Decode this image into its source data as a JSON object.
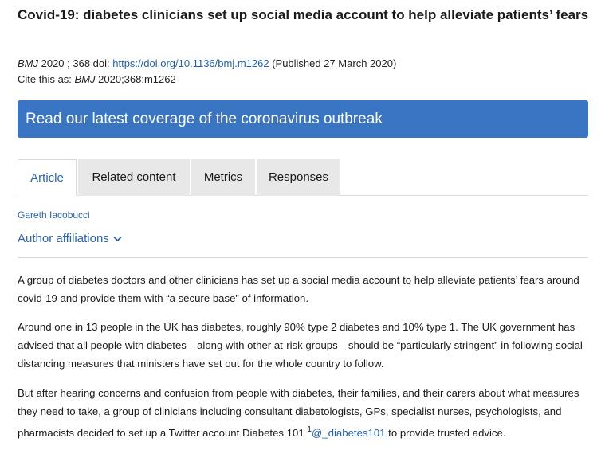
{
  "article": {
    "title": "Covid-19: diabetes clinicians set up social media account to help alleviate patients’ fears",
    "journal": "BMJ",
    "year_vol": " 2020 ; 368 ",
    "doi_label": " doi: ",
    "doi_link": "https://doi.org/10.1136/bmj.m1262",
    "published": " (Published 27 March 2020)",
    "cite_label": "Cite this as: ",
    "cite_journal": "BMJ",
    "cite_ref": " 2020;368:m1262"
  },
  "banner": {
    "text": "Read our latest coverage of the coronavirus outbreak"
  },
  "tabs": [
    {
      "label": "Article"
    },
    {
      "label": "Related content"
    },
    {
      "label": "Metrics"
    },
    {
      "label": "Responses"
    }
  ],
  "author": {
    "name": "Gareth Iacobucci",
    "affiliations_label": "Author affiliations"
  },
  "body": {
    "p1": "A group of diabetes doctors and other clinicians has set up a social media account to help alleviate patients’ fears around covid-19 and provide them with “a secure base” of information.",
    "p2": "Around one in 13 people in the UK has diabetes, roughly 90% type 2 diabetes and 10% type 1. The UK government has advised that all people with diabetes—along with other at-risk groups—should be “particularly stringent” in following social distancing measures that ministers have set out for the whole country to follow.",
    "p3_start": "But after hearing concerns and confusion from people with diabetes, their families, and their carers about what measures they need to take, a group of clinicians including consultant diabetologists, GPs, specialist nurses, psychologists, and pharmacists decided to set up a Twitter account Diabetes 101 ",
    "p3_ref": "1",
    "p3_handle": "@_diabetes101",
    "p3_end": " to provide trusted advice."
  },
  "colors": {
    "accent": "#2a64b6",
    "banner": "#3a75c4",
    "tab_inactive": "#e8e8e8"
  },
  "icons": {
    "affiliations_toggle": "chevron-down-icon"
  }
}
